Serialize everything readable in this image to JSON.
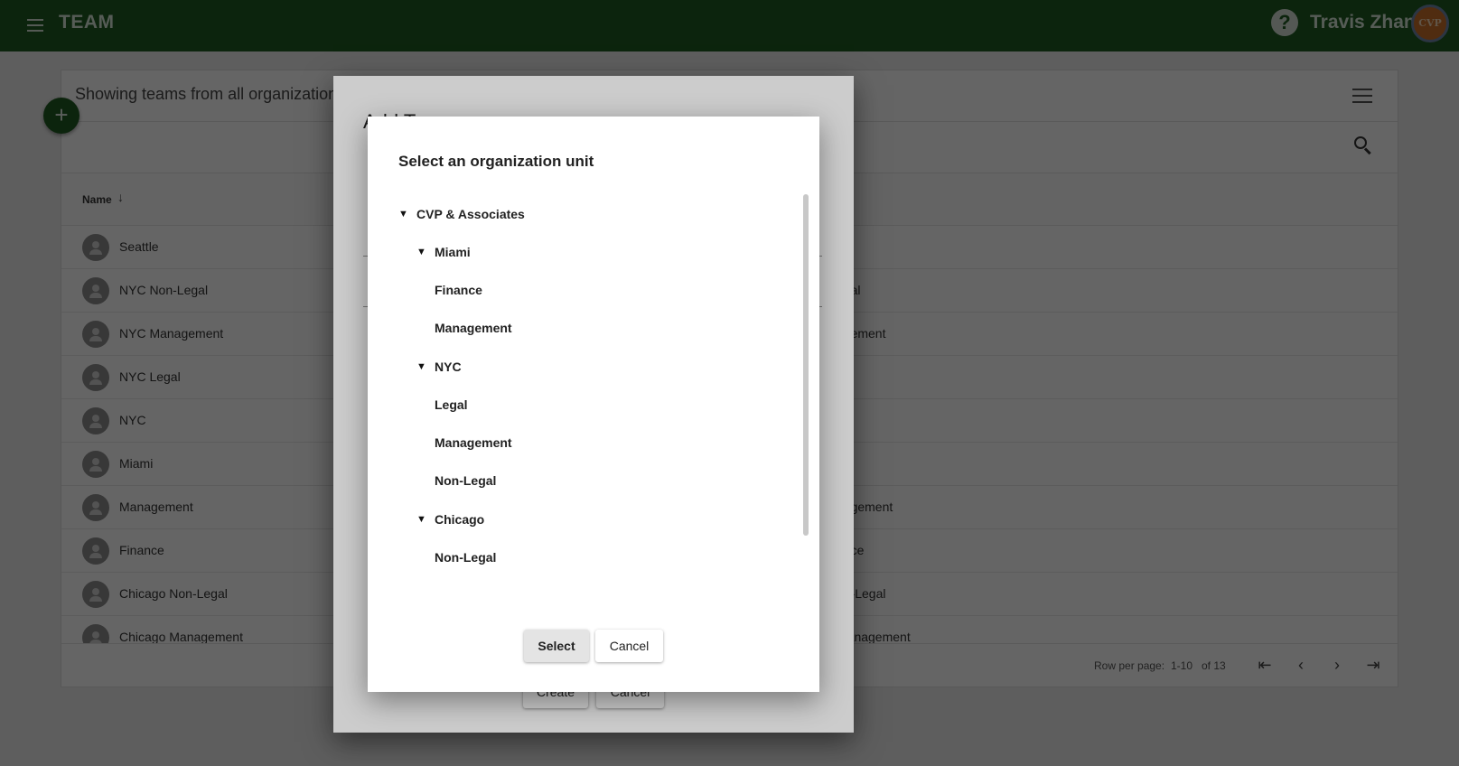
{
  "appbar": {
    "title": "TEAM",
    "user_name": "Travis Zhan",
    "avatar_text": "CVP"
  },
  "card": {
    "title": "Showing teams from all organization u",
    "column_name": "Name",
    "rows": [
      {
        "name": "Seattle",
        "col2": ""
      },
      {
        "name": "NYC Non-Legal",
        "col2": "egal"
      },
      {
        "name": "NYC Management",
        "col2": "agement"
      },
      {
        "name": "NYC Legal",
        "col2": ""
      },
      {
        "name": "NYC",
        "col2": ""
      },
      {
        "name": "Miami",
        "col2": ""
      },
      {
        "name": "Management",
        "col2": "nagement"
      },
      {
        "name": "Finance",
        "col2": "ance"
      },
      {
        "name": "Chicago Non-Legal",
        "col2": "on-Legal"
      },
      {
        "name": "Chicago Management",
        "col2": "Management"
      }
    ],
    "footer": {
      "rows_per_page_label": "Row per page:",
      "range": "1-10",
      "of": "of 13"
    }
  },
  "dialog_create": {
    "title": "Add Team",
    "create_label": "Create",
    "cancel_label": "Cancel"
  },
  "org_dialog": {
    "title": "Select an organization unit",
    "tree": [
      {
        "label": "CVP & Associates",
        "expandable": true
      },
      {
        "label": "Miami",
        "expandable": true
      },
      {
        "label": "Finance",
        "expandable": false
      },
      {
        "label": "Management",
        "expandable": false
      },
      {
        "label": "NYC",
        "expandable": true
      },
      {
        "label": "Legal",
        "expandable": false
      },
      {
        "label": "Management",
        "expandable": false
      },
      {
        "label": "Non-Legal",
        "expandable": false
      },
      {
        "label": "Chicago",
        "expandable": true
      },
      {
        "label": "Non-Legal",
        "expandable": false
      }
    ],
    "caret": "▼",
    "select_label": "Select",
    "cancel_label": "Cancel"
  },
  "colors": {
    "appbar": "#1f5d23",
    "accent": "#1f5d23"
  }
}
